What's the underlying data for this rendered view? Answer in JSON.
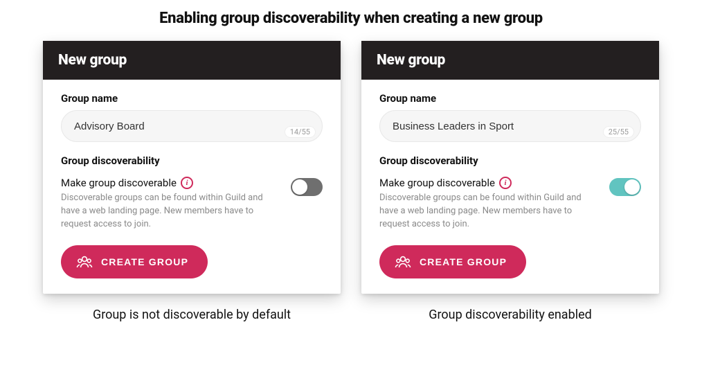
{
  "title": "Enabling group discoverability when creating a new group",
  "colors": {
    "accent": "#cf2a5b",
    "toggle_on": "#61c4c0",
    "toggle_off": "#6f6f6f"
  },
  "panels": [
    {
      "header": "New group",
      "group_name_label": "Group name",
      "group_name_value": "Advisory Board",
      "char_count": "14/55",
      "discoverability_label": "Group discoverability",
      "toggle_title": "Make group discoverable",
      "toggle_desc": "Discoverable groups can be found within Guild and have a web landing page. New members have to request access to join.",
      "toggle_on": false,
      "create_label": "CREATE GROUP",
      "caption": "Group is not discoverable by default"
    },
    {
      "header": "New group",
      "group_name_label": "Group name",
      "group_name_value": "Business Leaders in Sport",
      "char_count": "25/55",
      "discoverability_label": "Group discoverability",
      "toggle_title": "Make group discoverable",
      "toggle_desc": "Discoverable groups can be found within Guild and have a web landing page. New members have to request access to join.",
      "toggle_on": true,
      "create_label": "CREATE GROUP",
      "caption": "Group discoverability enabled"
    }
  ]
}
